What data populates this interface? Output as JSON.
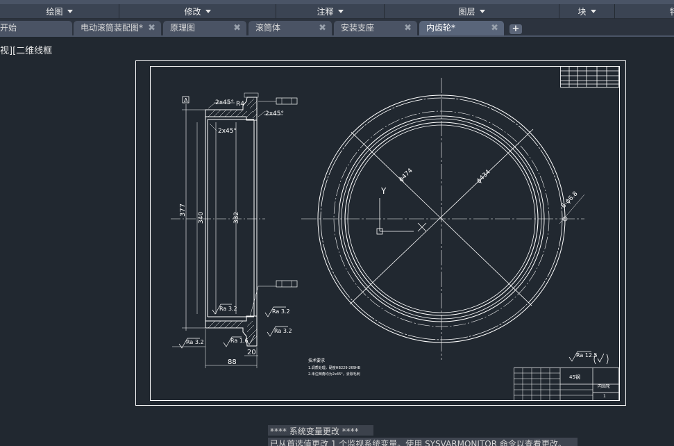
{
  "ribbon": {
    "panels": [
      {
        "label": "绘图"
      },
      {
        "label": "修改"
      },
      {
        "label": "注释"
      },
      {
        "label": "图层"
      },
      {
        "label": "块"
      },
      {
        "label": "特"
      }
    ]
  },
  "tabs": [
    {
      "label": "开始"
    },
    {
      "label": "电动滚筒装配图*"
    },
    {
      "label": "原理图"
    },
    {
      "label": "滚筒体"
    },
    {
      "label": "安装支座"
    },
    {
      "label": "内齿轮*"
    }
  ],
  "new_tab_symbol": "+",
  "close_symbol": "✖",
  "viewport_label": "视][二维线框",
  "drawing": {
    "section_view": {
      "dim_377": "377",
      "dim_340": "340",
      "dim_332": "332",
      "dim_88": "88",
      "dim_20": "20",
      "chamfer_top_left": "2x45°",
      "chamfer_top_right": "2x45°",
      "chamfer_inner": "2x45°",
      "radius": "R4",
      "datum": "A",
      "rough_32_a": "Ra 3.2",
      "rough_32_b": "Ra 3.2",
      "rough_32_c": "Ra 3.2",
      "rough_32_d": "Ra 3.2",
      "rough_16": "Ra 1.6"
    },
    "front_view": {
      "dia_474": "ϕ474",
      "dia_434": "ϕ434",
      "holes": "6-ϕ6.8",
      "ucs_y": "Y"
    },
    "tech_req_title": "技术要求",
    "tech_req_1": "1.调质处理，硬度HB229-269HB",
    "tech_req_2": "2.未注倒角均为2x45°，去除毛刺",
    "general_roughness": "Ra 12.5",
    "title_block": {
      "material": "45钢",
      "part_name": "内齿轮",
      "sheet_no": "1"
    }
  },
  "command_line": {
    "line1": "**** 系统变量更改 ****",
    "line2": "已从首选值更改 1 个监视系统变量。使用 SYSVARMONITOR 命令以查看更改。"
  },
  "colors": {
    "background": "#212830",
    "drawing_lines": "#ffffff"
  }
}
